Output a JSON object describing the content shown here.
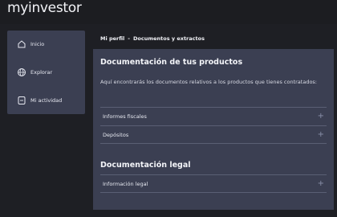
{
  "app": {
    "logo": "myinvestor"
  },
  "sidebar": {
    "items": [
      {
        "label": "Inicio",
        "icon": "home-icon"
      },
      {
        "label": "Explorar",
        "icon": "globe-icon"
      },
      {
        "label": "Mi actividad",
        "icon": "activity-icon"
      }
    ]
  },
  "breadcrumb": {
    "parent": "Mi perfil",
    "separator": "-",
    "current": "Documentos y extractos"
  },
  "products": {
    "title": "Documentación de tus productos",
    "description": "Aquí encontrarás los documentos relativos a los productos que tienes contratados:",
    "rows": [
      {
        "label": "Informes fiscales",
        "action": "+"
      },
      {
        "label": "Depósitos",
        "action": "+"
      }
    ]
  },
  "legal": {
    "title": "Documentación legal",
    "rows": [
      {
        "label": "Información legal",
        "action": "+"
      }
    ]
  },
  "colors": {
    "background": "#1e1f24",
    "panel": "#3b3f52",
    "divider": "#5a5f74",
    "accent": "#8a90aa"
  }
}
